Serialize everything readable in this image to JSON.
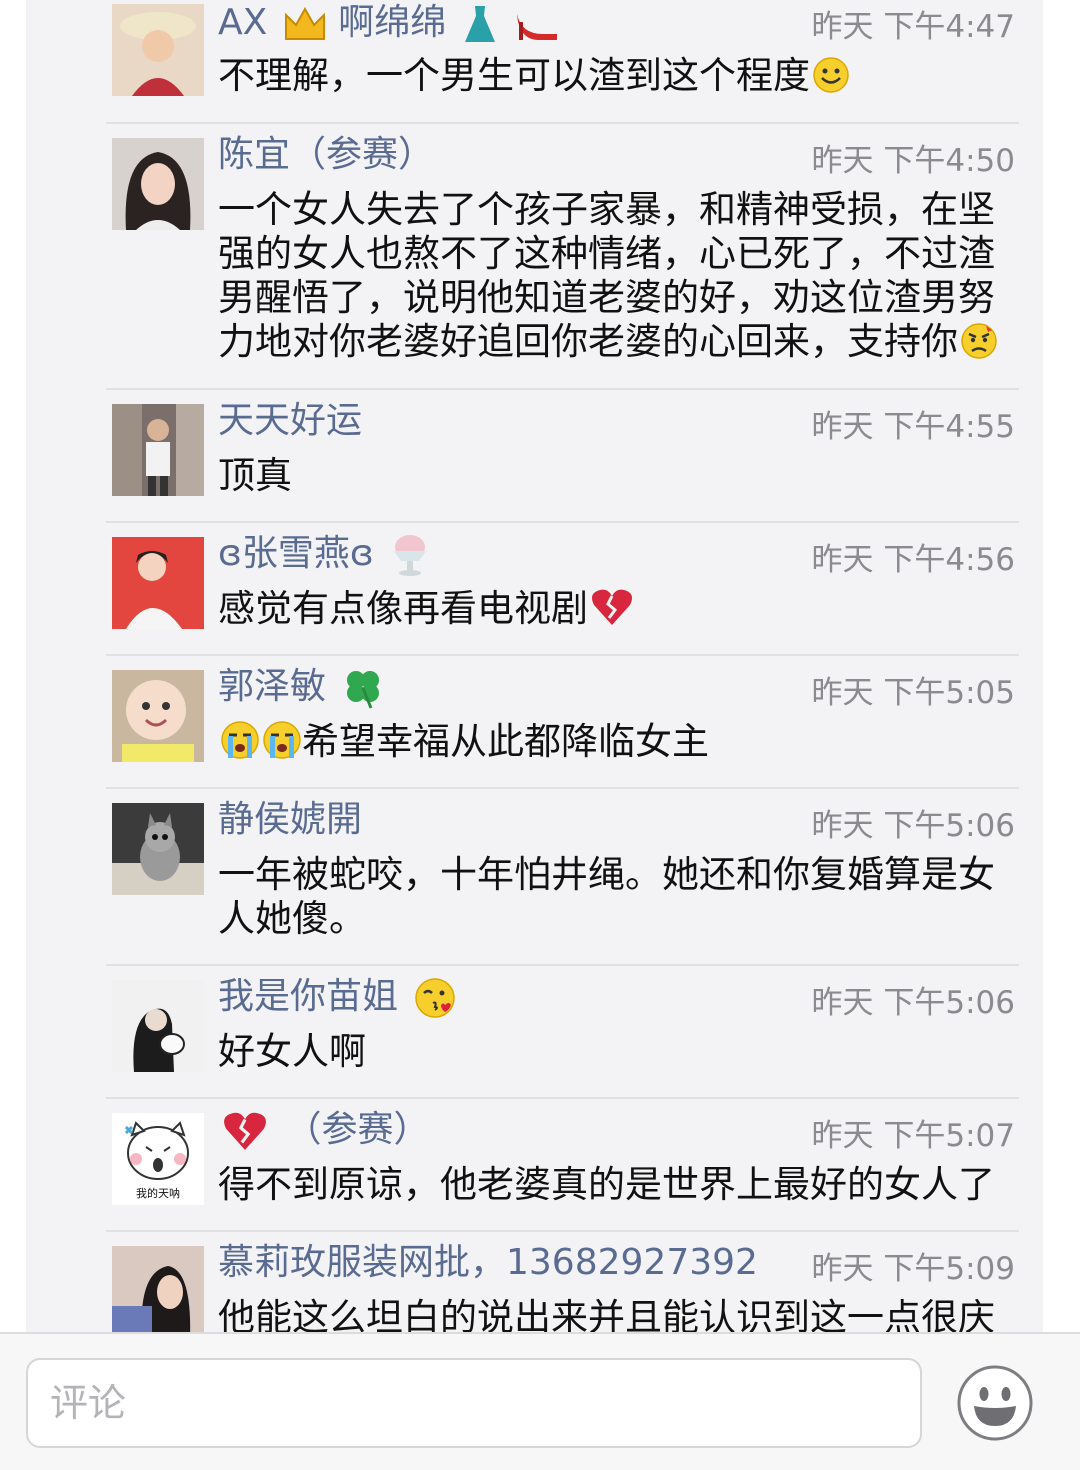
{
  "comments": [
    {
      "name": "AX",
      "name_suffix": "啊绵绵",
      "time": "昨天 下午4:47",
      "text": "不理解，一个男生可以渣到这个程度"
    },
    {
      "name": "陈宜（参赛）",
      "time": "昨天 下午4:50",
      "text": "一个女人失去了个孩子家暴，和精神受损，在坚强的女人也熬不了这种情绪，心已死了，不过渣男醒悟了，说明他知道老婆的好，劝这位渣男努力地对你老婆好追回你老婆的心回来，支持你"
    },
    {
      "name": "天天好运",
      "time": "昨天 下午4:55",
      "text": "顶真"
    },
    {
      "name": "ɞ张雪燕ɞ",
      "time": "昨天 下午4:56",
      "text": "感觉有点像再看电视剧"
    },
    {
      "name": "郭泽敏",
      "time": "昨天 下午5:05",
      "text": "希望幸福从此都降临女主"
    },
    {
      "name": "静侯婋開",
      "time": "昨天 下午5:06",
      "text": "一年被蛇咬，十年怕井绳。她还和你复婚算是女人她傻。"
    },
    {
      "name": "我是你苗姐",
      "time": "昨天 下午5:06",
      "text": "好女人啊"
    },
    {
      "name": "（参赛）",
      "time": "昨天 下午5:07",
      "text": "得不到原谅，他老婆真的是世界上最好的女人了",
      "avatar_caption": "我的天呐"
    },
    {
      "name": "慕莉玫服装网批，13682927392",
      "time": "昨天 下午5:09",
      "text": "他能这么坦白的说出来并且能认识到这一点很庆"
    }
  ],
  "input": {
    "placeholder": "评论"
  },
  "icons": {
    "emoji_button": "smiley-face-icon"
  }
}
